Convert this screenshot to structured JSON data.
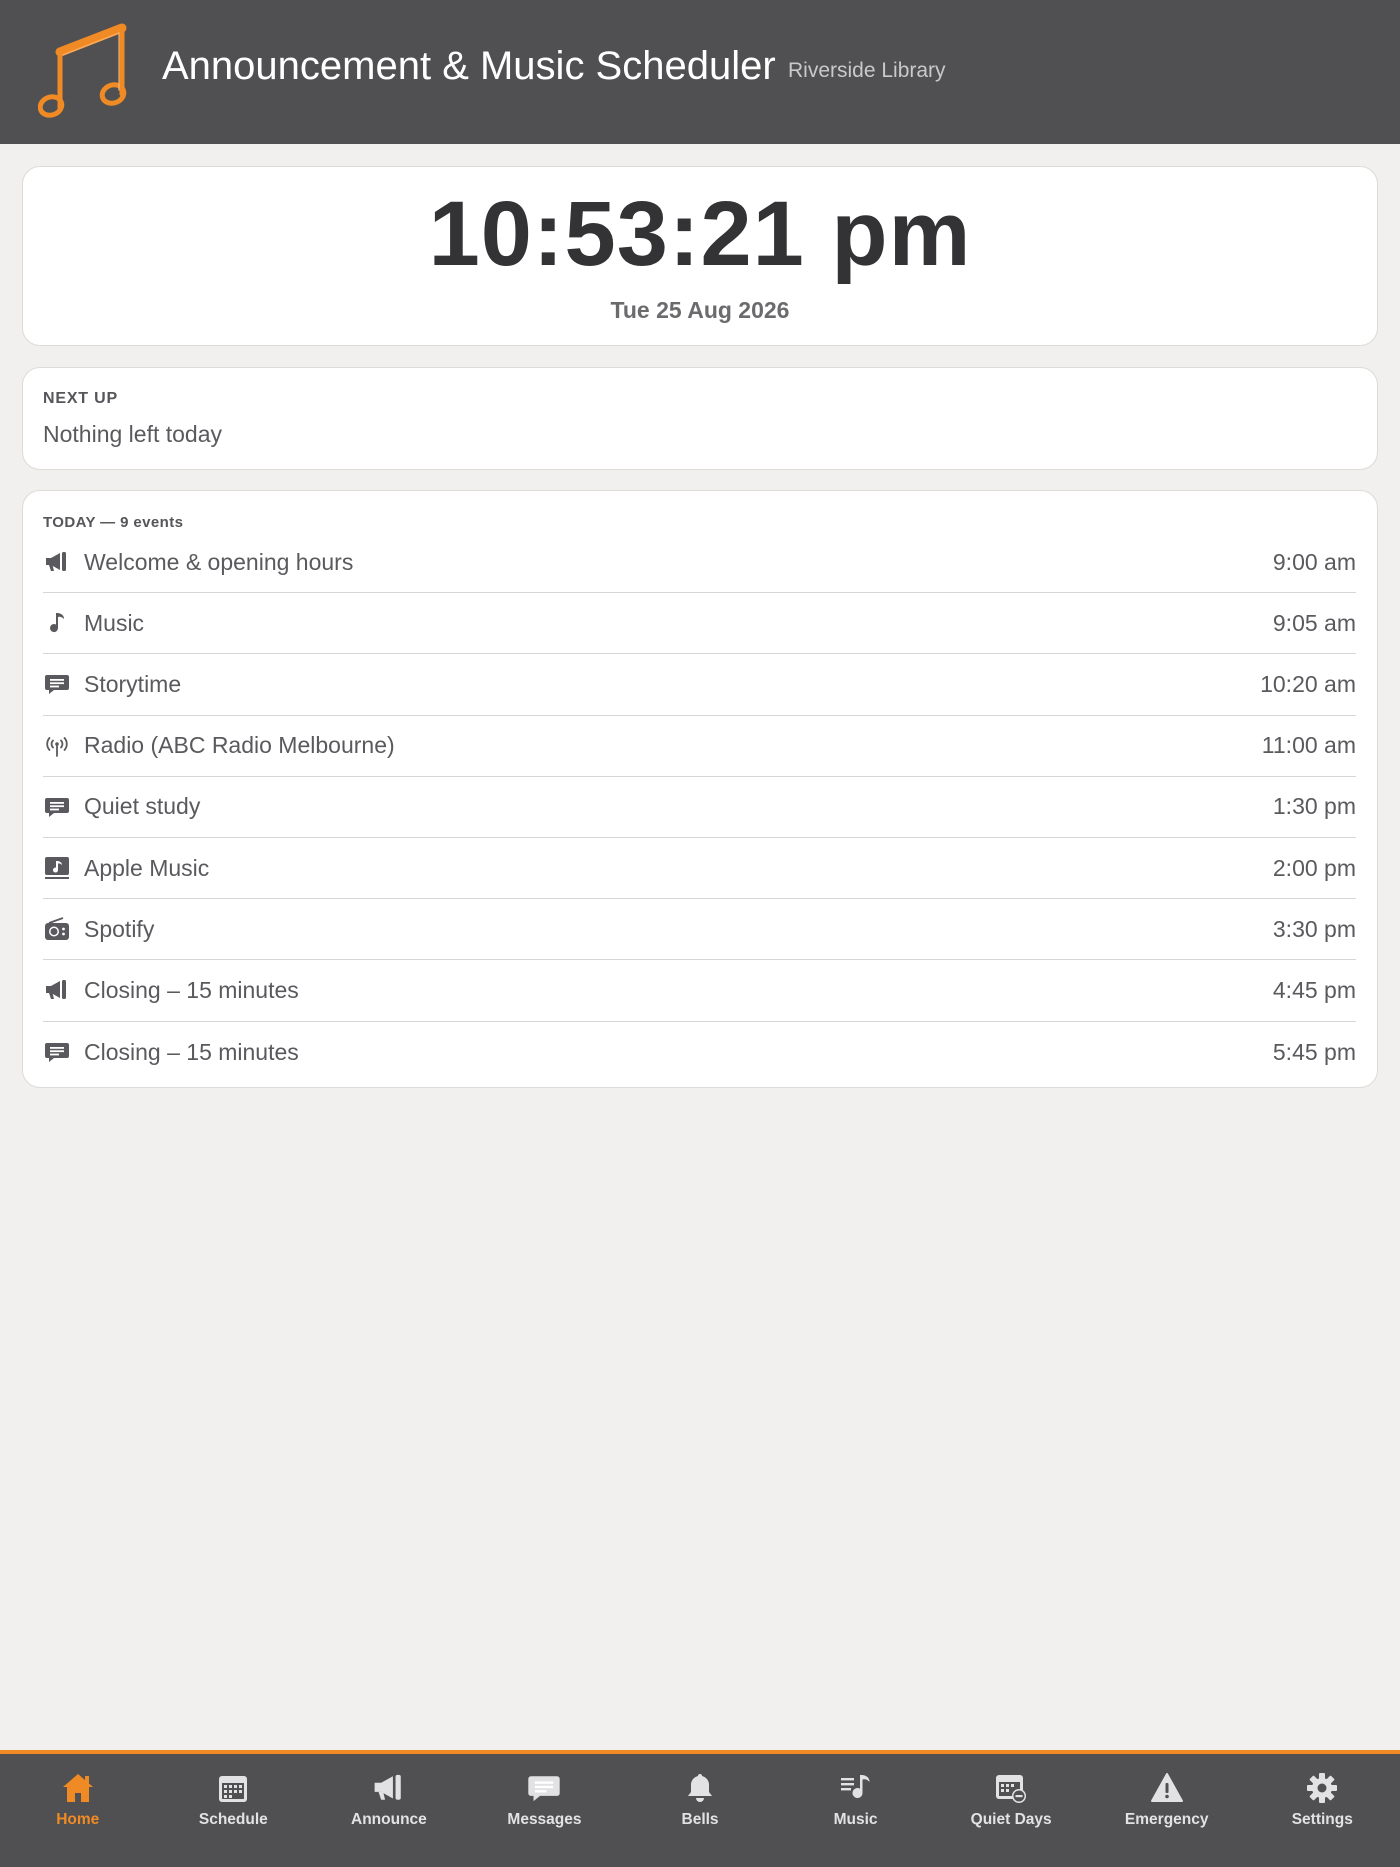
{
  "header": {
    "title": "Announcement & Music Scheduler",
    "location": "Riverside Library",
    "logo_icon": "music-note-icon",
    "logo_color": "#f08a24"
  },
  "clock": {
    "time": "10:53:21 pm",
    "date": "Tue 25 Aug 2026"
  },
  "next_up": {
    "label": "NEXT UP",
    "value": "Nothing left today"
  },
  "today": {
    "header": "TODAY — 9 events",
    "events": [
      {
        "icon": "megaphone-icon",
        "name": "Welcome & opening hours",
        "time": "9:00 am"
      },
      {
        "icon": "music-note-icon",
        "name": "Music",
        "time": "9:05 am"
      },
      {
        "icon": "message-icon",
        "name": "Storytime",
        "time": "10:20 am"
      },
      {
        "icon": "radio-antenna-icon",
        "name": "Radio (ABC Radio Melbourne)",
        "time": "11:00 am"
      },
      {
        "icon": "message-icon",
        "name": "Quiet study",
        "time": "1:30 pm"
      },
      {
        "icon": "music-display-icon",
        "name": "Apple Music",
        "time": "2:00 pm"
      },
      {
        "icon": "radio-icon",
        "name": "Spotify",
        "time": "3:30 pm"
      },
      {
        "icon": "megaphone-icon",
        "name": "Closing – 15 minutes",
        "time": "4:45 pm"
      },
      {
        "icon": "message-icon",
        "name": "Closing – 15 minutes",
        "time": "5:45 pm"
      }
    ]
  },
  "tabs": [
    {
      "icon": "home-icon",
      "label": "Home",
      "active": true
    },
    {
      "icon": "calendar-icon",
      "label": "Schedule"
    },
    {
      "icon": "megaphone-icon",
      "label": "Announce"
    },
    {
      "icon": "message-icon",
      "label": "Messages"
    },
    {
      "icon": "bell-icon",
      "label": "Bells"
    },
    {
      "icon": "music-list-icon",
      "label": "Music"
    },
    {
      "icon": "calendar-minus-icon",
      "label": "Quiet Days"
    },
    {
      "icon": "warning-icon",
      "label": "Emergency"
    },
    {
      "icon": "gear-icon",
      "label": "Settings"
    }
  ],
  "colors": {
    "header_bg": "#505052",
    "accent": "#f08a24",
    "page_bg": "#f1f0ee",
    "card_bg": "#ffffff"
  }
}
